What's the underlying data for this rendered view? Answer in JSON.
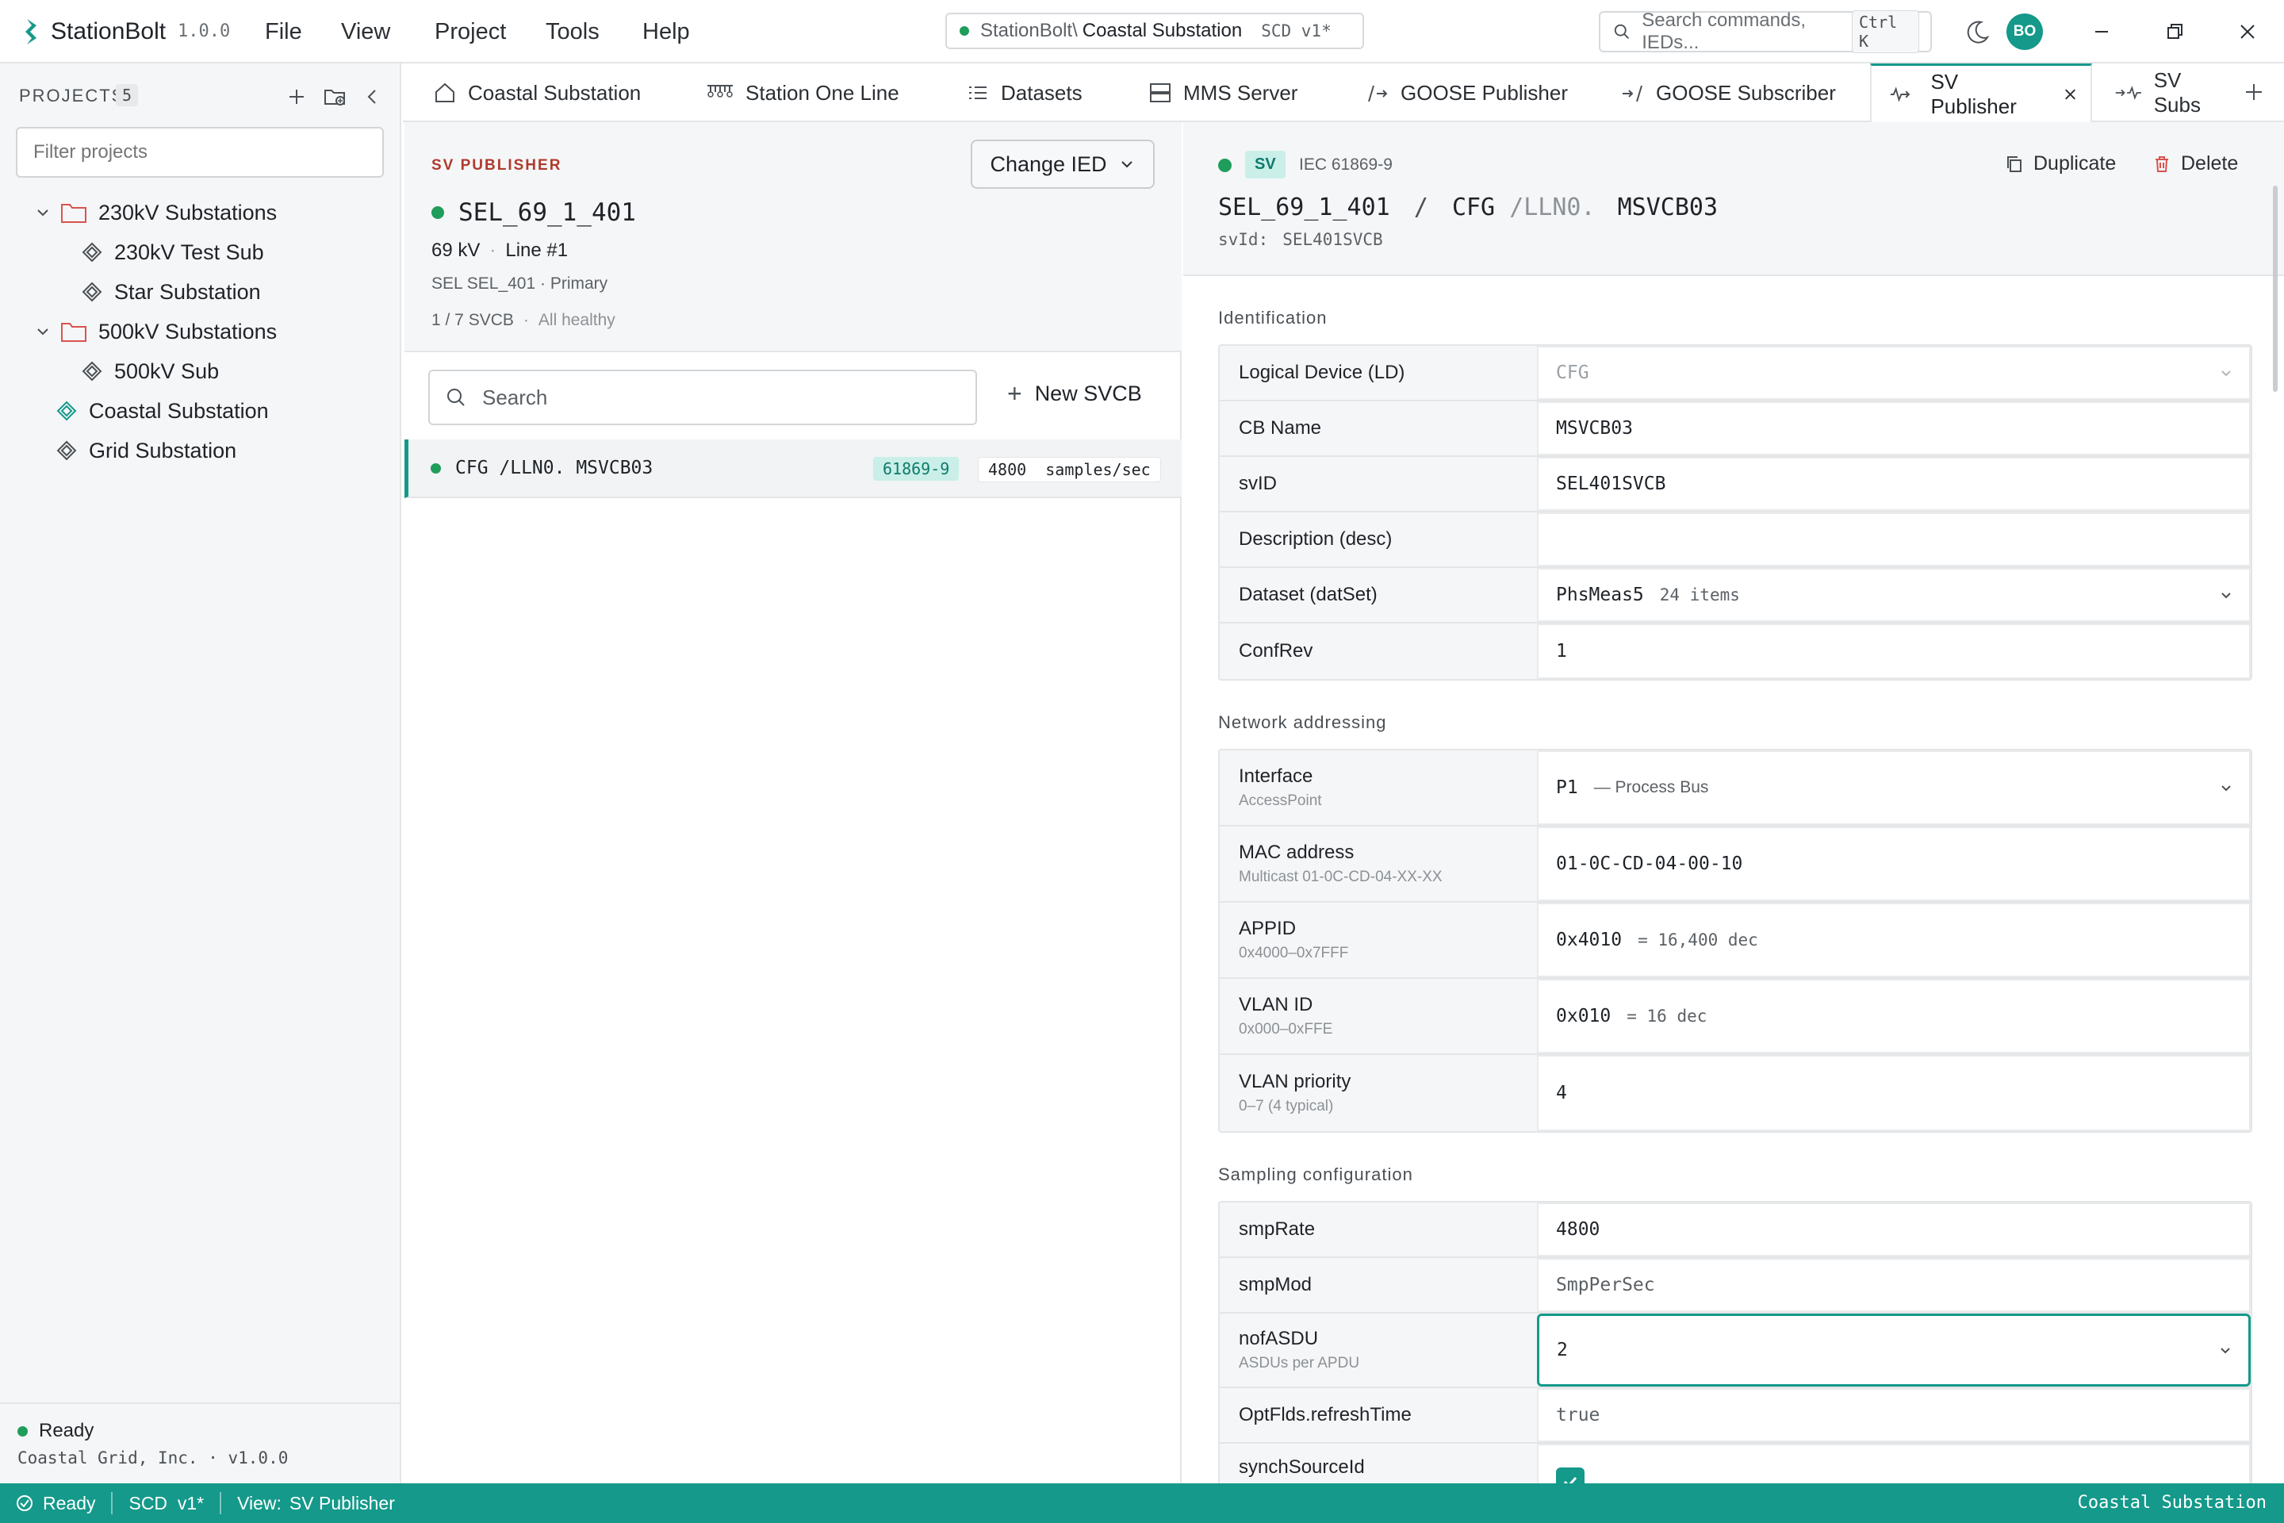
{
  "app": {
    "name": "StationBolt",
    "version": "1.0.0"
  },
  "menu": [
    "File",
    "View",
    "Project",
    "Tools",
    "Help"
  ],
  "path": {
    "prefix": "StationBolt\\",
    "current": "Coastal Substation",
    "file_version": "SCD v1*"
  },
  "command_search": {
    "placeholder": "Search commands, IEDs...",
    "shortcut": "Ctrl K"
  },
  "user": {
    "initials": "BO"
  },
  "sidebar": {
    "header": "PROJECTS",
    "count": "5",
    "filter_placeholder": "Filter projects",
    "tree": [
      {
        "label": "230kV Substations",
        "type": "folder"
      },
      {
        "label": "230kV Test Sub",
        "type": "station"
      },
      {
        "label": "Star Substation",
        "type": "station"
      },
      {
        "label": "500kV Substations",
        "type": "folder"
      },
      {
        "label": "500kV Sub",
        "type": "station"
      },
      {
        "label": "Coastal Substation",
        "type": "station-active"
      },
      {
        "label": "Grid Substation",
        "type": "station"
      }
    ],
    "status": "Ready",
    "company": "Coastal Grid, Inc. · v1.0.0"
  },
  "tabs": [
    {
      "label": "Coastal Substation",
      "icon": "home-icon"
    },
    {
      "label": "Station One Line",
      "icon": "one-line-icon"
    },
    {
      "label": "Datasets",
      "icon": "list-icon"
    },
    {
      "label": "MMS Server",
      "icon": "server-icon"
    },
    {
      "label": "GOOSE Publisher",
      "icon": "goose-publish-icon"
    },
    {
      "label": "GOOSE Subscriber",
      "icon": "goose-subscribe-icon"
    },
    {
      "label": "SV Publisher",
      "icon": "sv-publish-icon",
      "active": true
    },
    {
      "label": "SV Subs",
      "icon": "sv-subscribe-icon"
    }
  ],
  "ied": {
    "section_label": "SV PUBLISHER",
    "change_button": "Change IED",
    "name": "SEL_69_1_401",
    "voltage": "69 kV",
    "line": "Line #1",
    "model": "SEL SEL_401 · Primary",
    "svcb_count": "1 / 7 SVCB",
    "health": "All healthy",
    "search_placeholder": "Search",
    "new_button": "New SVCB",
    "svcb_list": [
      {
        "name": "CFG /LLN0. MSVCB03",
        "standard": "61869-9",
        "rate": "4800  samples/sec"
      }
    ]
  },
  "detail": {
    "badge": "SV",
    "standard": "IEC 61869-9",
    "duplicate": "Duplicate",
    "delete": "Delete",
    "title_ied": "SEL_69_1_401",
    "title_sep": "/",
    "title_ld": "CFG",
    "title_ln": "/LLN0.",
    "title_cb": "MSVCB03",
    "svid_label": "svId:",
    "svid_value": "SEL401SVCB",
    "identification": {
      "title": "Identification",
      "rows": [
        {
          "label": "Logical Device (LD)",
          "value": "CFG"
        },
        {
          "label": "CB Name",
          "value": "MSVCB03"
        },
        {
          "label": "svID",
          "value": "SEL401SVCB"
        },
        {
          "label": "Description (desc)",
          "value": ""
        },
        {
          "label": "Dataset (datSet)",
          "value": "PhsMeas5",
          "sub": "24 items"
        },
        {
          "label": "ConfRev",
          "value": "1"
        }
      ]
    },
    "network": {
      "title": "Network addressing",
      "rows": [
        {
          "label": "Interface",
          "hint": "AccessPoint",
          "value": "P1",
          "sub": "—  Process Bus"
        },
        {
          "label": "MAC address",
          "hint": "Multicast 01-0C-CD-04-XX-XX",
          "value": "01-0C-CD-04-00-10"
        },
        {
          "label": "APPID",
          "hint": "0x4000–0x7FFF",
          "value": "0x4010",
          "sub": "= 16,400 dec"
        },
        {
          "label": "VLAN ID",
          "hint": "0x000–0xFFE",
          "value": "0x010",
          "sub": "= 16 dec"
        },
        {
          "label": "VLAN priority",
          "hint": "0–7 (4 typical)",
          "value": "4"
        }
      ]
    },
    "sampling": {
      "title": "Sampling configuration",
      "rows": [
        {
          "label": "smpRate",
          "value": "4800"
        },
        {
          "label": "smpMod",
          "value": "SmpPerSec"
        },
        {
          "label": "nofASDU",
          "hint": "ASDUs per APDU",
          "value": "2"
        },
        {
          "label": "OptFlds.refreshTime",
          "value": "true"
        },
        {
          "label": "synchSourceId",
          "value": "checked"
        }
      ]
    }
  },
  "statusbar": {
    "ready": "Ready",
    "file": "SCD  v1*",
    "view_label": "View:",
    "view_value": "SV Publisher",
    "right": "Coastal Substation"
  },
  "colors": {
    "accent": "#14998a",
    "ok": "#1f9d5a",
    "section_red": "#b03a2e"
  }
}
